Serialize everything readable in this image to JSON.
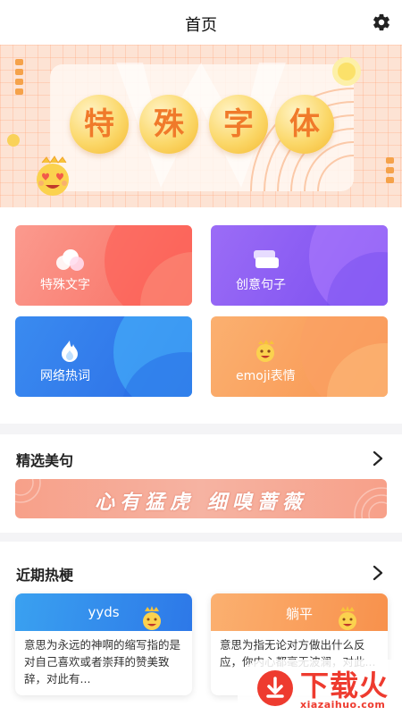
{
  "header": {
    "title": "首页",
    "settings_icon": "gear-icon"
  },
  "banner": {
    "chars": [
      "特",
      "殊",
      "字",
      "体"
    ],
    "colors": {
      "accent": "#f07a2a",
      "bubble": "#fbd86a"
    }
  },
  "features": [
    {
      "label": "特殊文字",
      "icon": "clouds-icon",
      "color": "#f86e62"
    },
    {
      "label": "创意句子",
      "icon": "cards-icon",
      "color": "#7b4ef0"
    },
    {
      "label": "网络热词",
      "icon": "flame-icon",
      "color": "#2c6de6"
    },
    {
      "label": "emoji表情",
      "icon": "emoji-face-icon",
      "color": "#f89550"
    }
  ],
  "quotes": {
    "title": "精选美句",
    "banner_text": "心有猛虎 细嗅蔷薇"
  },
  "hot": {
    "title": "近期热梗",
    "items": [
      {
        "term": "yyds",
        "desc": "意思为永远的神啊的缩写指的是对自己喜欢或者崇拜的赞美致辞，对此有..."
      },
      {
        "term": "躺平",
        "desc": "意思为指无论对方做出什么反应，你内心都毫无波澜，对此..."
      }
    ]
  },
  "watermark": {
    "brand": "下载火",
    "site": "xiazaihuo.com"
  }
}
